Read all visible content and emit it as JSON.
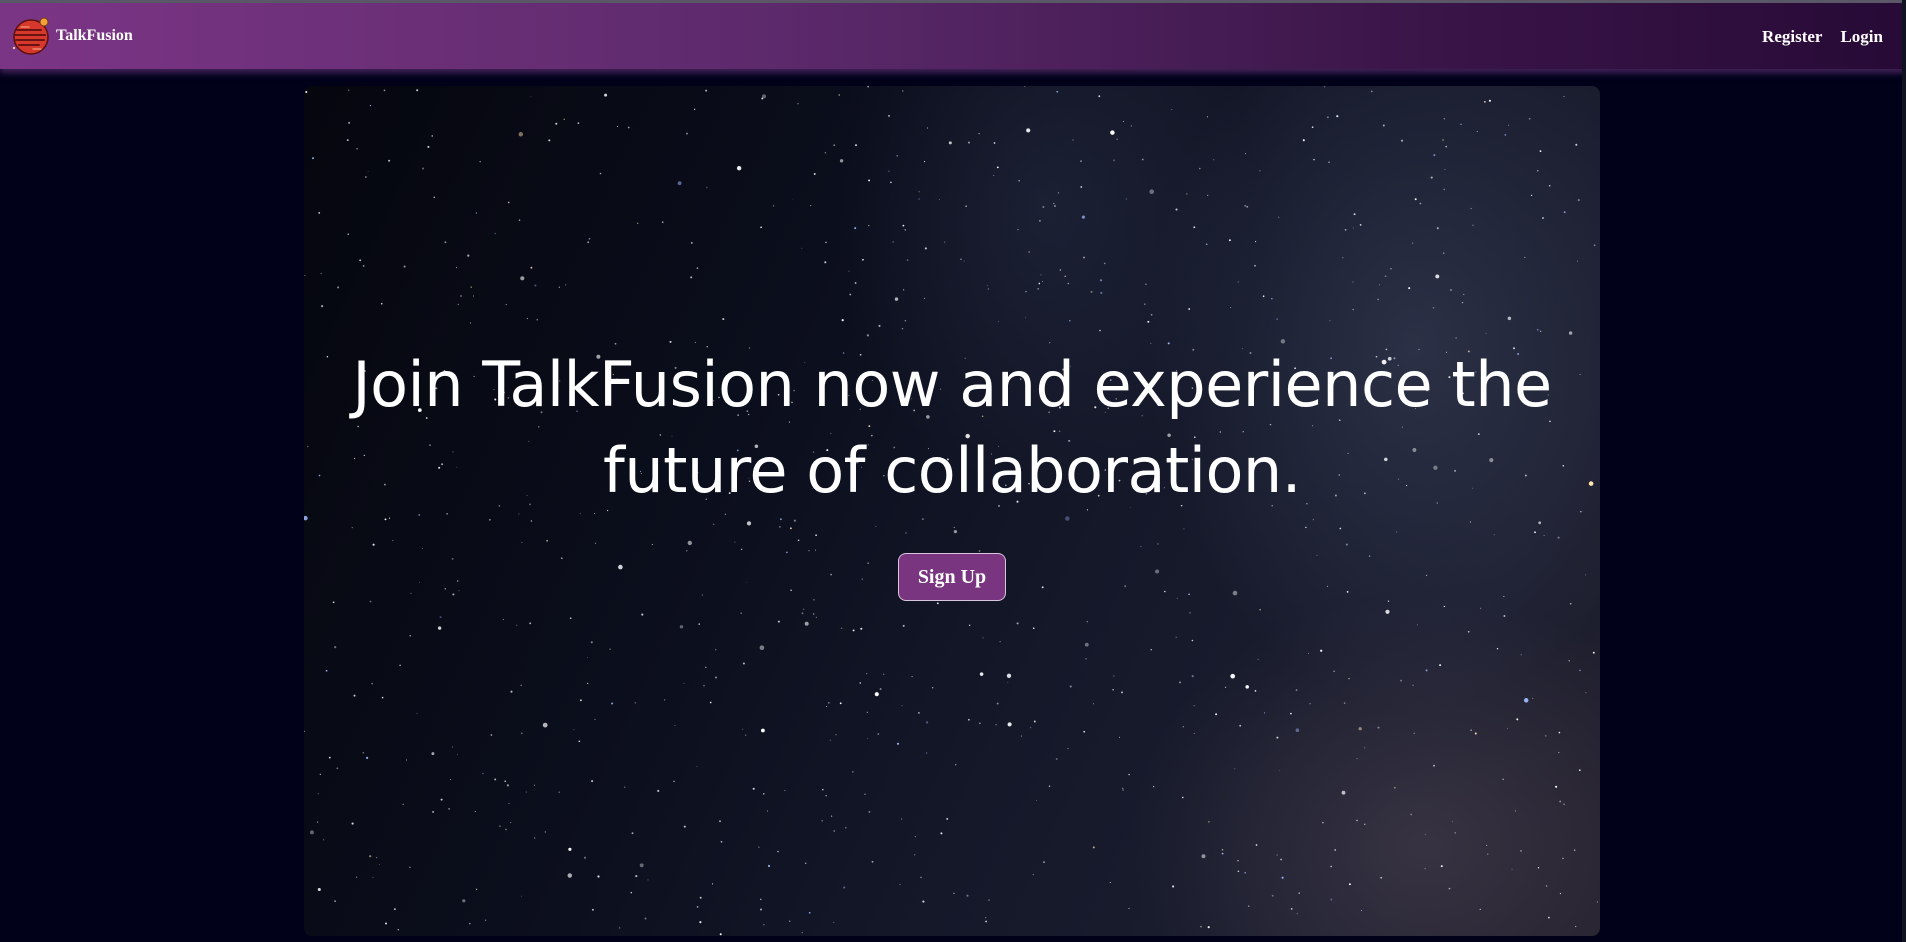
{
  "app": {
    "brand_name": "TalkFusion",
    "logo_icon": "planet-logo-icon"
  },
  "nav": {
    "register_label": "Register",
    "login_label": "Login"
  },
  "hero": {
    "headline": "Join TalkFusion now and experience the future of collaboration.",
    "cta_label": "Sign Up",
    "background": "starry-night-sky"
  },
  "colors": {
    "page_background": "#01021a",
    "navbar_start": "#7b3585",
    "navbar_end": "#270a36",
    "cta_background": "#7a3581",
    "cta_border": "#d9c6dd",
    "text": "#ffffff"
  }
}
